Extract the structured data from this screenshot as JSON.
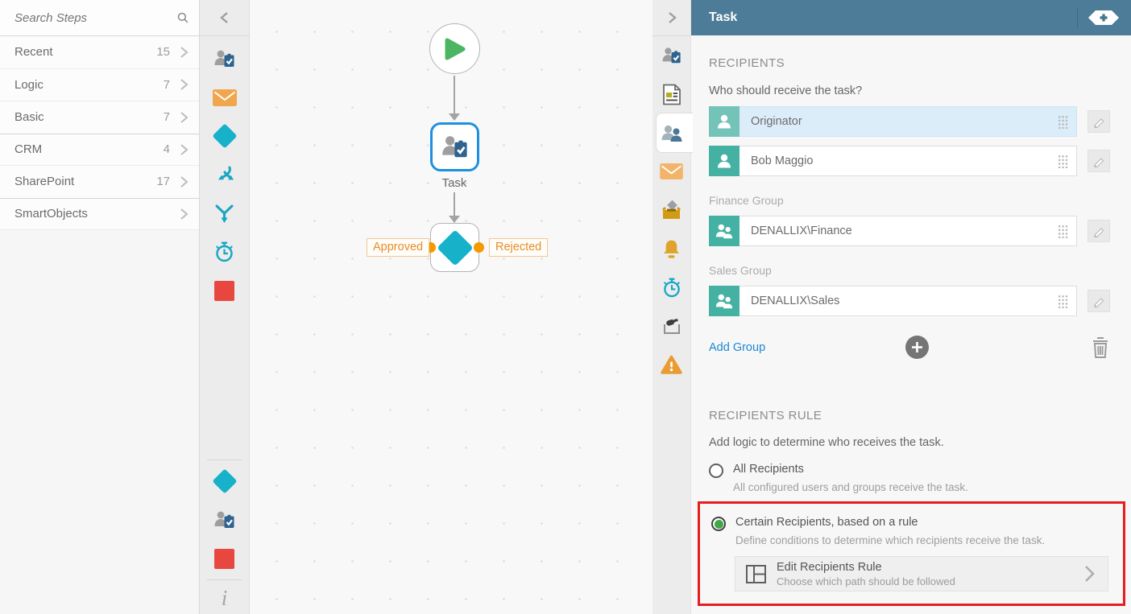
{
  "left_panel": {
    "search": {
      "placeholder": "Search Steps"
    },
    "categories": [
      {
        "label": "Recent",
        "count": "15"
      },
      {
        "label": "Logic",
        "count": "7"
      },
      {
        "label": "Basic",
        "count": "7"
      },
      {
        "label": "CRM",
        "count": "4"
      },
      {
        "label": "SharePoint",
        "count": "17"
      },
      {
        "label": "SmartObjects",
        "count": ""
      }
    ]
  },
  "left_strip": {
    "icons": [
      "collapse-chevron",
      "user-task",
      "email",
      "decision-diamond",
      "split-arrows",
      "merge-arrows",
      "timer",
      "end-step",
      "decision-diamond",
      "user-task",
      "end-step",
      "info"
    ]
  },
  "canvas": {
    "task_label": "Task",
    "outcomes": [
      {
        "label": "Approved"
      },
      {
        "label": "Rejected"
      }
    ]
  },
  "right_strip": {
    "icons": [
      "expand-chevron",
      "user-task",
      "form",
      "recipients",
      "email",
      "actions-box",
      "notification-bell",
      "timer",
      "vote-hand",
      "warning"
    ]
  },
  "panel": {
    "title": "Task",
    "recipients": {
      "heading": "RECIPIENTS",
      "question": "Who should receive the task?",
      "rows": [
        {
          "group_label": "",
          "value": "Originator",
          "type": "user",
          "selected": true
        },
        {
          "group_label": "",
          "value": "Bob Maggio",
          "type": "user",
          "selected": false
        },
        {
          "group_label": "Finance Group",
          "value": "DENALLIX\\Finance",
          "type": "group",
          "selected": false
        },
        {
          "group_label": "Sales Group",
          "value": "DENALLIX\\Sales",
          "type": "group",
          "selected": false
        }
      ],
      "add_group_label": "Add Group"
    },
    "rule": {
      "heading": "RECIPIENTS RULE",
      "description": "Add logic to determine who receives the task.",
      "options": [
        {
          "label": "All Recipients",
          "description": "All configured users and groups receive the task.",
          "selected": false
        },
        {
          "label": "Certain Recipients, based on a rule",
          "description": "Define conditions to determine which recipients receive the task.",
          "selected": true
        }
      ],
      "edit_button": {
        "title": "Edit Recipients Rule",
        "subtitle": "Choose which path should be followed"
      }
    }
  },
  "colors": {
    "header_teal": "#4d7c98",
    "accent_teal": "#17b1ca",
    "avatar_teal": "#44b1a2",
    "selected_row_blue": "#dcedfa",
    "task_border_blue": "#1f8fe0",
    "outcome_orange": "#f49a00",
    "link_blue": "#1b87d3",
    "radio_green": "#43a749",
    "annotation_red": "#e41e1e",
    "step_red": "#e8473f",
    "start_green": "#4cb563"
  }
}
